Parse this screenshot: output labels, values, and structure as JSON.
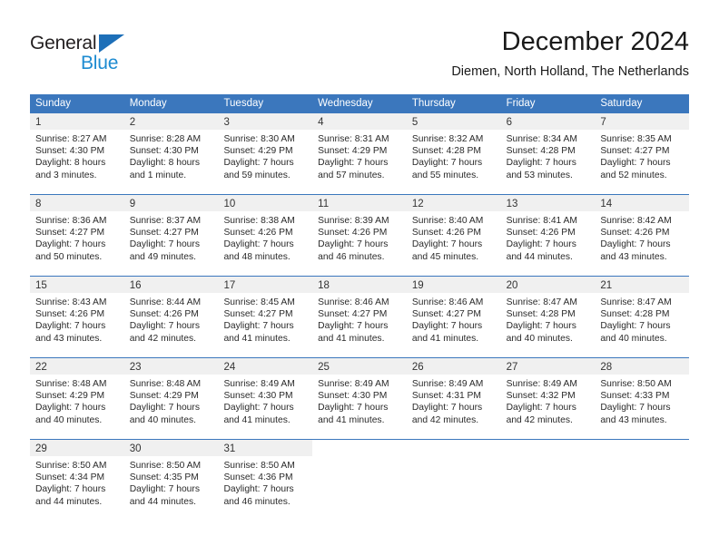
{
  "logo": {
    "word_one": "General",
    "word_two": "Blue",
    "triangle_color": "#1d6fb8",
    "blue_color": "#1d8bd1"
  },
  "header": {
    "title": "December 2024",
    "subtitle": "Diemen, North Holland, The Netherlands"
  },
  "theme": {
    "header_blue": "#3b77bd",
    "daynum_band": "#f0f0f0",
    "text": "#2a2a2a"
  },
  "weekdays": [
    "Sunday",
    "Monday",
    "Tuesday",
    "Wednesday",
    "Thursday",
    "Friday",
    "Saturday"
  ],
  "weeks": [
    [
      {
        "day": "1",
        "sunrise": "Sunrise: 8:27 AM",
        "sunset": "Sunset: 4:30 PM",
        "daylight_1": "Daylight: 8 hours",
        "daylight_2": "and 3 minutes."
      },
      {
        "day": "2",
        "sunrise": "Sunrise: 8:28 AM",
        "sunset": "Sunset: 4:30 PM",
        "daylight_1": "Daylight: 8 hours",
        "daylight_2": "and 1 minute."
      },
      {
        "day": "3",
        "sunrise": "Sunrise: 8:30 AM",
        "sunset": "Sunset: 4:29 PM",
        "daylight_1": "Daylight: 7 hours",
        "daylight_2": "and 59 minutes."
      },
      {
        "day": "4",
        "sunrise": "Sunrise: 8:31 AM",
        "sunset": "Sunset: 4:29 PM",
        "daylight_1": "Daylight: 7 hours",
        "daylight_2": "and 57 minutes."
      },
      {
        "day": "5",
        "sunrise": "Sunrise: 8:32 AM",
        "sunset": "Sunset: 4:28 PM",
        "daylight_1": "Daylight: 7 hours",
        "daylight_2": "and 55 minutes."
      },
      {
        "day": "6",
        "sunrise": "Sunrise: 8:34 AM",
        "sunset": "Sunset: 4:28 PM",
        "daylight_1": "Daylight: 7 hours",
        "daylight_2": "and 53 minutes."
      },
      {
        "day": "7",
        "sunrise": "Sunrise: 8:35 AM",
        "sunset": "Sunset: 4:27 PM",
        "daylight_1": "Daylight: 7 hours",
        "daylight_2": "and 52 minutes."
      }
    ],
    [
      {
        "day": "8",
        "sunrise": "Sunrise: 8:36 AM",
        "sunset": "Sunset: 4:27 PM",
        "daylight_1": "Daylight: 7 hours",
        "daylight_2": "and 50 minutes."
      },
      {
        "day": "9",
        "sunrise": "Sunrise: 8:37 AM",
        "sunset": "Sunset: 4:27 PM",
        "daylight_1": "Daylight: 7 hours",
        "daylight_2": "and 49 minutes."
      },
      {
        "day": "10",
        "sunrise": "Sunrise: 8:38 AM",
        "sunset": "Sunset: 4:26 PM",
        "daylight_1": "Daylight: 7 hours",
        "daylight_2": "and 48 minutes."
      },
      {
        "day": "11",
        "sunrise": "Sunrise: 8:39 AM",
        "sunset": "Sunset: 4:26 PM",
        "daylight_1": "Daylight: 7 hours",
        "daylight_2": "and 46 minutes."
      },
      {
        "day": "12",
        "sunrise": "Sunrise: 8:40 AM",
        "sunset": "Sunset: 4:26 PM",
        "daylight_1": "Daylight: 7 hours",
        "daylight_2": "and 45 minutes."
      },
      {
        "day": "13",
        "sunrise": "Sunrise: 8:41 AM",
        "sunset": "Sunset: 4:26 PM",
        "daylight_1": "Daylight: 7 hours",
        "daylight_2": "and 44 minutes."
      },
      {
        "day": "14",
        "sunrise": "Sunrise: 8:42 AM",
        "sunset": "Sunset: 4:26 PM",
        "daylight_1": "Daylight: 7 hours",
        "daylight_2": "and 43 minutes."
      }
    ],
    [
      {
        "day": "15",
        "sunrise": "Sunrise: 8:43 AM",
        "sunset": "Sunset: 4:26 PM",
        "daylight_1": "Daylight: 7 hours",
        "daylight_2": "and 43 minutes."
      },
      {
        "day": "16",
        "sunrise": "Sunrise: 8:44 AM",
        "sunset": "Sunset: 4:26 PM",
        "daylight_1": "Daylight: 7 hours",
        "daylight_2": "and 42 minutes."
      },
      {
        "day": "17",
        "sunrise": "Sunrise: 8:45 AM",
        "sunset": "Sunset: 4:27 PM",
        "daylight_1": "Daylight: 7 hours",
        "daylight_2": "and 41 minutes."
      },
      {
        "day": "18",
        "sunrise": "Sunrise: 8:46 AM",
        "sunset": "Sunset: 4:27 PM",
        "daylight_1": "Daylight: 7 hours",
        "daylight_2": "and 41 minutes."
      },
      {
        "day": "19",
        "sunrise": "Sunrise: 8:46 AM",
        "sunset": "Sunset: 4:27 PM",
        "daylight_1": "Daylight: 7 hours",
        "daylight_2": "and 41 minutes."
      },
      {
        "day": "20",
        "sunrise": "Sunrise: 8:47 AM",
        "sunset": "Sunset: 4:28 PM",
        "daylight_1": "Daylight: 7 hours",
        "daylight_2": "and 40 minutes."
      },
      {
        "day": "21",
        "sunrise": "Sunrise: 8:47 AM",
        "sunset": "Sunset: 4:28 PM",
        "daylight_1": "Daylight: 7 hours",
        "daylight_2": "and 40 minutes."
      }
    ],
    [
      {
        "day": "22",
        "sunrise": "Sunrise: 8:48 AM",
        "sunset": "Sunset: 4:29 PM",
        "daylight_1": "Daylight: 7 hours",
        "daylight_2": "and 40 minutes."
      },
      {
        "day": "23",
        "sunrise": "Sunrise: 8:48 AM",
        "sunset": "Sunset: 4:29 PM",
        "daylight_1": "Daylight: 7 hours",
        "daylight_2": "and 40 minutes."
      },
      {
        "day": "24",
        "sunrise": "Sunrise: 8:49 AM",
        "sunset": "Sunset: 4:30 PM",
        "daylight_1": "Daylight: 7 hours",
        "daylight_2": "and 41 minutes."
      },
      {
        "day": "25",
        "sunrise": "Sunrise: 8:49 AM",
        "sunset": "Sunset: 4:30 PM",
        "daylight_1": "Daylight: 7 hours",
        "daylight_2": "and 41 minutes."
      },
      {
        "day": "26",
        "sunrise": "Sunrise: 8:49 AM",
        "sunset": "Sunset: 4:31 PM",
        "daylight_1": "Daylight: 7 hours",
        "daylight_2": "and 42 minutes."
      },
      {
        "day": "27",
        "sunrise": "Sunrise: 8:49 AM",
        "sunset": "Sunset: 4:32 PM",
        "daylight_1": "Daylight: 7 hours",
        "daylight_2": "and 42 minutes."
      },
      {
        "day": "28",
        "sunrise": "Sunrise: 8:50 AM",
        "sunset": "Sunset: 4:33 PM",
        "daylight_1": "Daylight: 7 hours",
        "daylight_2": "and 43 minutes."
      }
    ],
    [
      {
        "day": "29",
        "sunrise": "Sunrise: 8:50 AM",
        "sunset": "Sunset: 4:34 PM",
        "daylight_1": "Daylight: 7 hours",
        "daylight_2": "and 44 minutes."
      },
      {
        "day": "30",
        "sunrise": "Sunrise: 8:50 AM",
        "sunset": "Sunset: 4:35 PM",
        "daylight_1": "Daylight: 7 hours",
        "daylight_2": "and 44 minutes."
      },
      {
        "day": "31",
        "sunrise": "Sunrise: 8:50 AM",
        "sunset": "Sunset: 4:36 PM",
        "daylight_1": "Daylight: 7 hours",
        "daylight_2": "and 46 minutes."
      },
      {
        "day": "",
        "sunrise": "",
        "sunset": "",
        "daylight_1": "",
        "daylight_2": ""
      },
      {
        "day": "",
        "sunrise": "",
        "sunset": "",
        "daylight_1": "",
        "daylight_2": ""
      },
      {
        "day": "",
        "sunrise": "",
        "sunset": "",
        "daylight_1": "",
        "daylight_2": ""
      },
      {
        "day": "",
        "sunrise": "",
        "sunset": "",
        "daylight_1": "",
        "daylight_2": ""
      }
    ]
  ]
}
